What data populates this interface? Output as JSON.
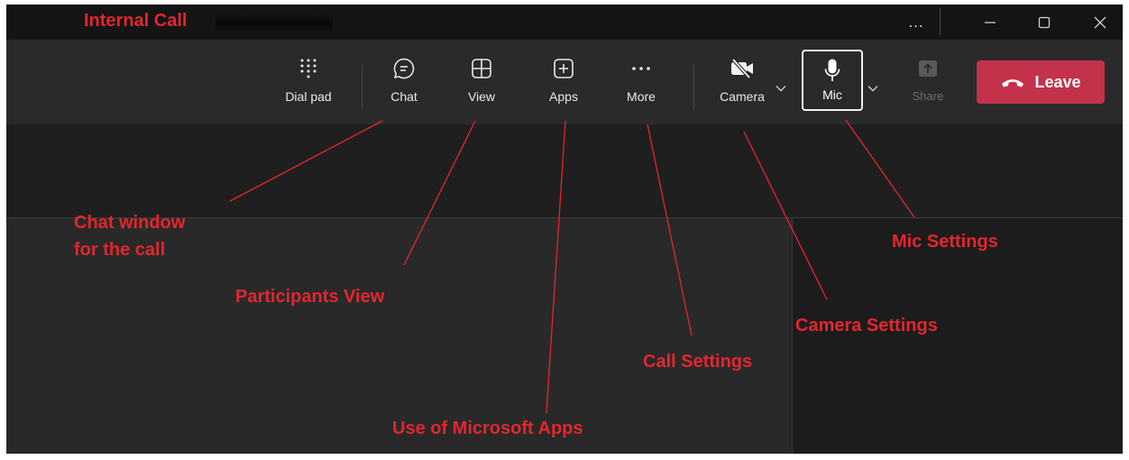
{
  "window": {
    "title": "Internal Call",
    "controls": {
      "more": "…",
      "minimize": "minimize-icon",
      "maximize": "maximize-icon",
      "close": "close-icon"
    }
  },
  "toolbar": {
    "dial_pad": {
      "label": "Dial pad",
      "icon": "dialpad-icon"
    },
    "chat": {
      "label": "Chat",
      "icon": "chat-bubble-icon"
    },
    "view": {
      "label": "View",
      "icon": "grid-view-icon"
    },
    "apps": {
      "label": "Apps",
      "icon": "add-app-icon"
    },
    "more": {
      "label": "More",
      "icon": "more-dots-icon"
    },
    "camera": {
      "label": "Camera",
      "icon": "camera-off-icon"
    },
    "mic": {
      "label": "Mic",
      "icon": "microphone-icon"
    },
    "share": {
      "label": "Share",
      "icon": "share-tray-icon"
    },
    "leave": {
      "label": "Leave",
      "icon": "hang-up-icon"
    }
  },
  "annotations": {
    "chat": [
      "Chat window",
      "for the call"
    ],
    "view": "Participants View",
    "apps": "Use of Microsoft Apps",
    "more": "Call Settings",
    "camera": "Camera Settings",
    "mic": "Mic Settings"
  },
  "colors": {
    "annotation": "#e3262e",
    "leave_button": "#c4314b",
    "toolbar_bg": "#2a2a2a",
    "titlebar_bg": "#141414"
  }
}
